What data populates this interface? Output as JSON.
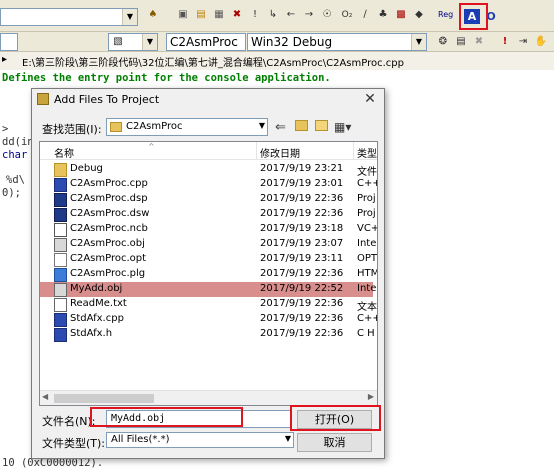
{
  "ide": {
    "toolbar_combo_class": "C2AsmProc",
    "toolbar_combo_config": "Win32 Debug",
    "path": "E:\\第三阶段\\第三阶段代码\\32位汇编\\第七讲_混合编程\\C2AsmProc\\C2AsmProc.cpp",
    "reg_label": "Reg",
    "highlight_btn_a": "A",
    "highlight_btn_b": "O",
    "code_comment": "Defines the entry point for the console application.",
    "code_frag1": "dd(in",
    "code_frag2": "char",
    "code_frag3": "%d\\",
    "code_frag4": "0);",
    "code_frag5": ">",
    "code_bottom": "10 (0xC0000012)."
  },
  "dialog": {
    "title": "Add Files To Project",
    "lookin_label": "查找范围(I):",
    "lookin_value": "C2AsmProc",
    "columns": {
      "name": "名称",
      "date": "修改日期",
      "type": "类型"
    },
    "files": [
      {
        "name": "Debug",
        "date": "2017/9/19 23:21",
        "type": "文件",
        "icon": "folder-icon"
      },
      {
        "name": "C2AsmProc.cpp",
        "date": "2017/9/19 23:01",
        "type": "C++",
        "icon": "cpp-file-icon"
      },
      {
        "name": "C2AsmProc.dsp",
        "date": "2017/9/19 22:36",
        "type": "Proj",
        "icon": "project-file-icon"
      },
      {
        "name": "C2AsmProc.dsw",
        "date": "2017/9/19 22:36",
        "type": "Proj",
        "icon": "workspace-file-icon"
      },
      {
        "name": "C2AsmProc.ncb",
        "date": "2017/9/19 23:18",
        "type": "VC+",
        "icon": "ncb-file-icon"
      },
      {
        "name": "C2AsmProc.obj",
        "date": "2017/9/19 23:07",
        "type": "Inte",
        "icon": "obj-file-icon"
      },
      {
        "name": "C2AsmProc.opt",
        "date": "2017/9/19 23:11",
        "type": "OPT",
        "icon": "opt-file-icon"
      },
      {
        "name": "C2AsmProc.plg",
        "date": "2017/9/19 22:36",
        "type": "HTM",
        "icon": "html-file-icon"
      },
      {
        "name": "MyAdd.obj",
        "date": "2017/9/19 22:52",
        "type": "Inte",
        "icon": "obj-file-icon",
        "selected": true
      },
      {
        "name": "ReadMe.txt",
        "date": "2017/9/19 22:36",
        "type": "文本",
        "icon": "text-file-icon"
      },
      {
        "name": "StdAfx.cpp",
        "date": "2017/9/19 22:36",
        "type": "C++",
        "icon": "cpp-file-icon"
      },
      {
        "name": "StdAfx.h",
        "date": "2017/9/19 22:36",
        "type": "C H",
        "icon": "header-file-icon"
      }
    ],
    "filename_label": "文件名(N):",
    "filename_value": "MyAdd.obj",
    "filetype_label": "文件类型(T):",
    "filetype_value": "All Files(*.*)",
    "open_button": "打开(O)",
    "cancel_button": "取消",
    "close_glyph": "✕"
  },
  "colors": {
    "annotation": "#e0141e",
    "selected_row": "#d98e8e",
    "comment": "#008000"
  }
}
